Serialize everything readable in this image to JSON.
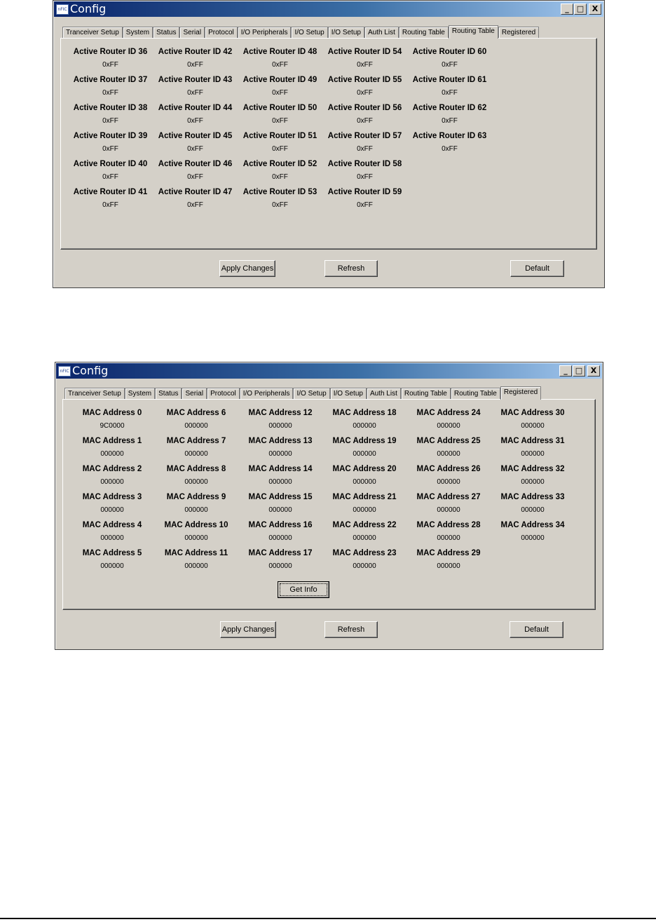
{
  "window1": {
    "title": "Config",
    "icon_text": "nFIC",
    "controls": [
      "_",
      "□",
      "X"
    ],
    "tabs": [
      "Tranceiver Setup",
      "System",
      "Status",
      "Serial",
      "Protocol",
      "I/O Peripherals",
      "I/O Setup",
      "I/O Setup",
      "Auth List",
      "Routing Table",
      "Routing Table",
      "Registered"
    ],
    "active_tab_index": 10,
    "routers": [
      {
        "label": "Active Router ID 36",
        "value": "0xFF"
      },
      {
        "label": "Active Router ID 37",
        "value": "0xFF"
      },
      {
        "label": "Active Router ID 38",
        "value": "0xFF"
      },
      {
        "label": "Active Router ID 39",
        "value": "0xFF"
      },
      {
        "label": "Active Router ID 40",
        "value": "0xFF"
      },
      {
        "label": "Active Router ID 41",
        "value": "0xFF"
      },
      {
        "label": "Active Router ID 42",
        "value": "0xFF"
      },
      {
        "label": "Active Router ID 43",
        "value": "0xFF"
      },
      {
        "label": "Active Router ID 44",
        "value": "0xFF"
      },
      {
        "label": "Active Router ID 45",
        "value": "0xFF"
      },
      {
        "label": "Active Router ID 46",
        "value": "0xFF"
      },
      {
        "label": "Active Router ID 47",
        "value": "0xFF"
      },
      {
        "label": "Active Router ID 48",
        "value": "0xFF"
      },
      {
        "label": "Active Router ID 49",
        "value": "0xFF"
      },
      {
        "label": "Active Router ID 50",
        "value": "0xFF"
      },
      {
        "label": "Active Router ID 51",
        "value": "0xFF"
      },
      {
        "label": "Active Router ID 52",
        "value": "0xFF"
      },
      {
        "label": "Active Router ID 53",
        "value": "0xFF"
      },
      {
        "label": "Active Router ID 54",
        "value": "0xFF"
      },
      {
        "label": "Active Router ID 55",
        "value": "0xFF"
      },
      {
        "label": "Active Router ID 56",
        "value": "0xFF"
      },
      {
        "label": "Active Router ID 57",
        "value": "0xFF"
      },
      {
        "label": "Active Router ID 58",
        "value": "0xFF"
      },
      {
        "label": "Active Router ID 59",
        "value": "0xFF"
      },
      {
        "label": "Active Router ID 60",
        "value": "0xFF"
      },
      {
        "label": "Active Router ID 61",
        "value": "0xFF"
      },
      {
        "label": "Active Router ID 62",
        "value": "0xFF"
      },
      {
        "label": "Active Router ID 63",
        "value": "0xFF"
      }
    ],
    "buttons": {
      "apply": "Apply Changes",
      "refresh": "Refresh",
      "default": "Default"
    }
  },
  "window2": {
    "title": "Config",
    "icon_text": "nFIC",
    "controls": [
      "_",
      "□",
      "X"
    ],
    "tabs": [
      "Tranceiver Setup",
      "System",
      "Status",
      "Serial",
      "Protocol",
      "I/O Peripherals",
      "I/O Setup",
      "I/O Setup",
      "Auth List",
      "Routing Table",
      "Routing Table",
      "Registered"
    ],
    "active_tab_index": 11,
    "macs": [
      {
        "label": "MAC Address 0",
        "value": "9C0000"
      },
      {
        "label": "MAC Address 1",
        "value": "000000"
      },
      {
        "label": "MAC Address 2",
        "value": "000000"
      },
      {
        "label": "MAC Address 3",
        "value": "000000"
      },
      {
        "label": "MAC Address 4",
        "value": "000000"
      },
      {
        "label": "MAC Address 5",
        "value": "000000"
      },
      {
        "label": "MAC Address 6",
        "value": "000000"
      },
      {
        "label": "MAC Address 7",
        "value": "000000"
      },
      {
        "label": "MAC Address 8",
        "value": "000000"
      },
      {
        "label": "MAC Address 9",
        "value": "000000"
      },
      {
        "label": "MAC Address 10",
        "value": "000000"
      },
      {
        "label": "MAC Address 11",
        "value": "000000"
      },
      {
        "label": "MAC Address 12",
        "value": "000000"
      },
      {
        "label": "MAC Address 13",
        "value": "000000"
      },
      {
        "label": "MAC Address 14",
        "value": "000000"
      },
      {
        "label": "MAC Address 15",
        "value": "000000"
      },
      {
        "label": "MAC Address 16",
        "value": "000000"
      },
      {
        "label": "MAC Address 17",
        "value": "000000"
      },
      {
        "label": "MAC Address 18",
        "value": "000000"
      },
      {
        "label": "MAC Address 19",
        "value": "000000"
      },
      {
        "label": "MAC Address 20",
        "value": "000000"
      },
      {
        "label": "MAC Address 21",
        "value": "000000"
      },
      {
        "label": "MAC Address 22",
        "value": "000000"
      },
      {
        "label": "MAC Address 23",
        "value": "000000"
      },
      {
        "label": "MAC Address 24",
        "value": "000000"
      },
      {
        "label": "MAC Address 25",
        "value": "000000"
      },
      {
        "label": "MAC Address 26",
        "value": "000000"
      },
      {
        "label": "MAC Address 27",
        "value": "000000"
      },
      {
        "label": "MAC Address 28",
        "value": "000000"
      },
      {
        "label": "MAC Address 29",
        "value": "000000"
      },
      {
        "label": "MAC Address 30",
        "value": "000000"
      },
      {
        "label": "MAC Address 31",
        "value": "000000"
      },
      {
        "label": "MAC Address 32",
        "value": "000000"
      },
      {
        "label": "MAC Address 33",
        "value": "000000"
      },
      {
        "label": "MAC Address 34",
        "value": "000000"
      }
    ],
    "get_info": "Get Info",
    "buttons": {
      "apply": "Apply Changes",
      "refresh": "Refresh",
      "default": "Default"
    }
  }
}
